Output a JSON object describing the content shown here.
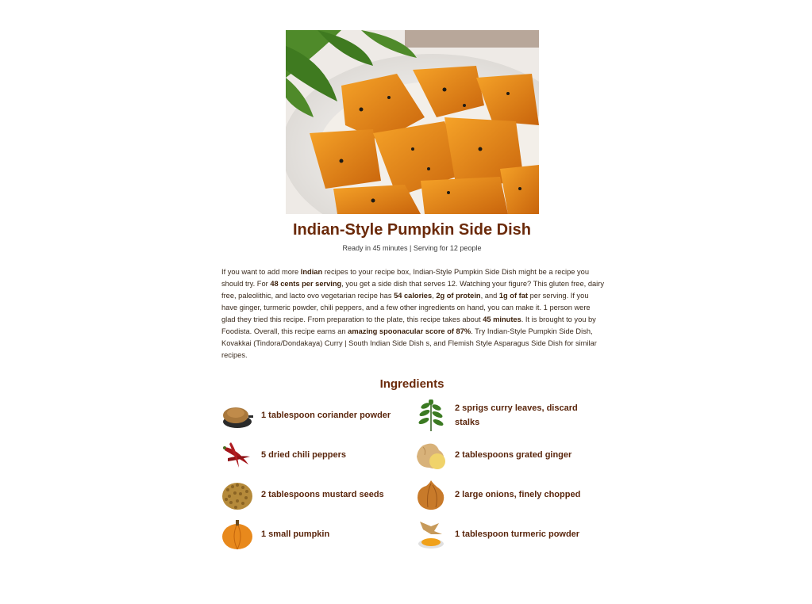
{
  "recipe": {
    "title": "Indian-Style Pumpkin Side Dish",
    "meta": "Ready in 45 minutes | Serving for 12 people",
    "summary": {
      "s1": "If you want to add more ",
      "b1": "Indian",
      "s2": " recipes to your recipe box, Indian-Style Pumpkin Side Dish might be a recipe you should try. For ",
      "b2": "48 cents per serving",
      "s3": ", you get a side dish that serves 12. Watching your figure? This gluten free, dairy free, paleolithic, and lacto ovo vegetarian recipe has ",
      "b3": "54 calories",
      "s4": ", ",
      "b4": "2g of protein",
      "s5": ", and ",
      "b5": "1g of fat",
      "s6": " per serving. If you have ginger, turmeric powder, chili peppers, and a few other ingredients on hand, you can make it. 1 person were glad they tried this recipe. From preparation to the plate, this recipe takes about ",
      "b6": "45 minutes",
      "s7": ". It is brought to you by Foodista. Overall, this recipe earns an ",
      "b7": "amazing spoonacular score of 87%",
      "s8": ". Try Indian-Style Pumpkin Side Dish, Kovakkai (Tindora/Dondakaya) Curry | South Indian Side Dish s, and Flemish Style Asparagus Side Dish for similar recipes."
    }
  },
  "ingredients": {
    "heading": "Ingredients",
    "items": [
      {
        "name": "1 tablespoon coriander powder",
        "icon": "coriander-powder-icon"
      },
      {
        "name": "2 sprigs curry leaves, discard stalks",
        "icon": "curry-leaves-icon"
      },
      {
        "name": "5 dried chili peppers",
        "icon": "chili-peppers-icon"
      },
      {
        "name": "2 tablespoons grated ginger",
        "icon": "ginger-icon"
      },
      {
        "name": "2 tablespoons mustard seeds",
        "icon": "mustard-seeds-icon"
      },
      {
        "name": "2 large onions, finely chopped",
        "icon": "onion-icon"
      },
      {
        "name": "1 small pumpkin",
        "icon": "pumpkin-icon"
      },
      {
        "name": "1 tablespoon turmeric powder",
        "icon": "turmeric-icon"
      }
    ]
  },
  "colors": {
    "title": "#6b2a0a",
    "text": "#3a2a1c",
    "pumpkin": "#e8891c"
  }
}
